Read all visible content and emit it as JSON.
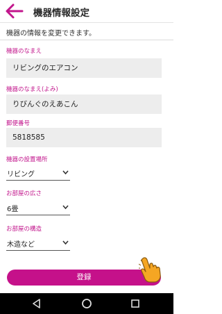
{
  "header": {
    "title": "機器情報設定",
    "back_icon": "back-arrow-icon",
    "accent": "#c2168c"
  },
  "description": "機器の情報を変更できます。",
  "form": {
    "device_name": {
      "label": "機器のなまえ",
      "value": "リビングのエアコン"
    },
    "device_name_kana": {
      "label": "機器のなまえ(よみ)",
      "value": "りびんぐのえあこん"
    },
    "postal_code": {
      "label": "郵便番号",
      "value": "5818585"
    },
    "install_location": {
      "label": "機器の設置場所",
      "value": "リビング"
    },
    "room_size": {
      "label": "お部屋の広さ",
      "value": "6畳"
    },
    "room_structure": {
      "label": "お部屋の構造",
      "value": "木造など"
    }
  },
  "submit_label": "登録",
  "submit_color": "#c5118a",
  "pointer_icon": "pointing-hand-icon",
  "navbar": {
    "back_icon": "nav-back-icon",
    "home_icon": "nav-home-icon",
    "recents_icon": "nav-recents-icon"
  }
}
